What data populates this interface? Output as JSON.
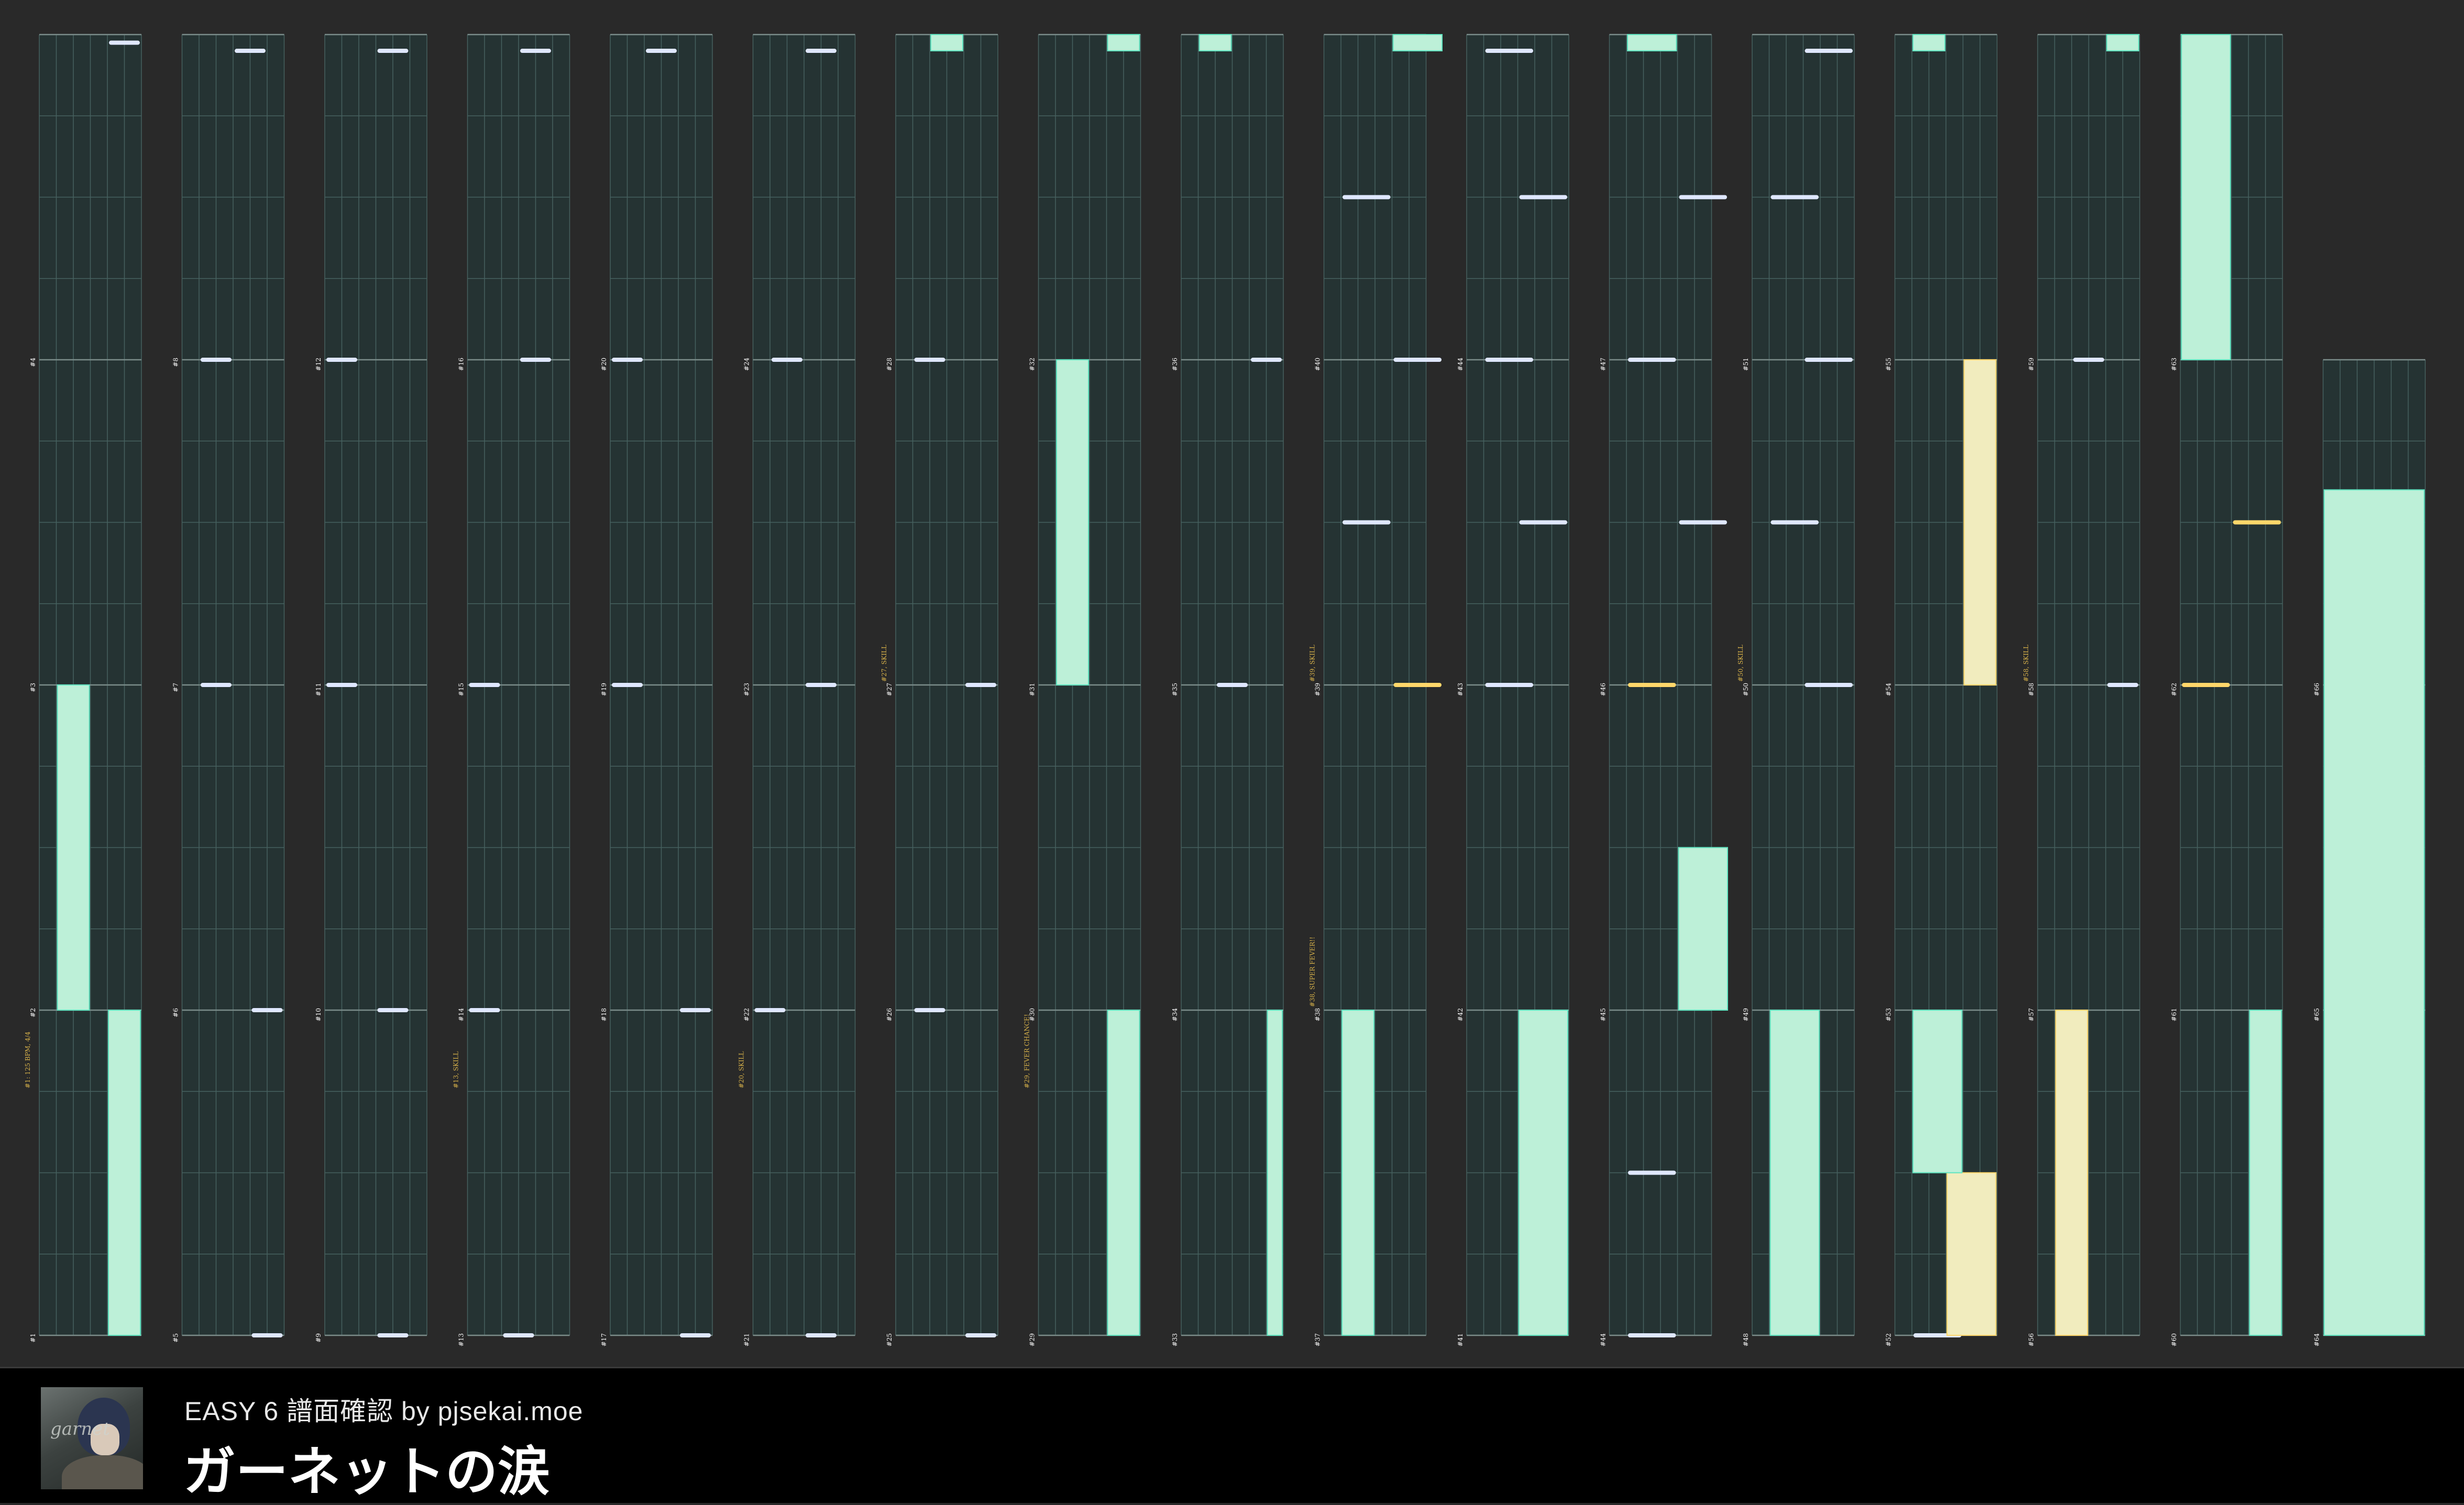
{
  "chart_header": {
    "difficulty": "EASY",
    "level": "6",
    "label": "譜面確認",
    "credit": "by pjsekai.moe",
    "full": "EASY 6 譜面確認 by pjsekai.moe"
  },
  "song": {
    "title": "ガーネットの涙",
    "jacket_icon": "album-jacket-icon"
  },
  "colors": {
    "background": "#292929",
    "lane_bg": "#253333",
    "lane_line": "#46615f",
    "beat_line": "#7b8c8a",
    "tap": "#dfe7ff",
    "flick": "#ffd76a",
    "hold": "#bdf0d8",
    "hold_edge": "#5fe4c0",
    "gold_hold": "#f1ecbe",
    "label_white": "#ffffff",
    "label_gold": "#d8b24a"
  },
  "columns": [
    {
      "measures": [
        "1",
        "2",
        "3",
        "4"
      ],
      "events": [
        {
          "m": 0,
          "b": 3,
          "text": "#1: 125 BPM, 4/4"
        }
      ],
      "notes": [
        {
          "t": "hold",
          "l": 8,
          "w": 4,
          "s": 0,
          "e": 4
        },
        {
          "t": "hold",
          "l": 2,
          "w": 4,
          "s": 4,
          "e": 8
        },
        {
          "t": "tap",
          "l": 8,
          "w": 4,
          "b": 15.9
        }
      ]
    },
    {
      "measures": [
        "5",
        "6",
        "7",
        "8"
      ],
      "events": [],
      "notes": [
        {
          "t": "tap",
          "l": 8,
          "w": 4,
          "b": 0
        },
        {
          "t": "tap",
          "l": 8,
          "w": 4,
          "b": 4
        },
        {
          "t": "tap",
          "l": 2,
          "w": 4,
          "b": 8
        },
        {
          "t": "tap",
          "l": 2,
          "w": 4,
          "b": 12
        },
        {
          "t": "tap",
          "l": 6,
          "w": 4,
          "b": 15.8
        }
      ]
    },
    {
      "measures": [
        "9",
        "10",
        "11",
        "12"
      ],
      "events": [],
      "notes": [
        {
          "t": "tap",
          "l": 6,
          "w": 4,
          "b": 0
        },
        {
          "t": "tap",
          "l": 6,
          "w": 4,
          "b": 4
        },
        {
          "t": "tap",
          "l": 0,
          "w": 4,
          "b": 8
        },
        {
          "t": "tap",
          "l": 0,
          "w": 4,
          "b": 12
        },
        {
          "t": "tap",
          "l": 6,
          "w": 4,
          "b": 15.8
        }
      ]
    },
    {
      "measures": [
        "13",
        "14",
        "15",
        "16"
      ],
      "events": [
        {
          "m": 0,
          "b": 3,
          "text": "#13, SKILL"
        }
      ],
      "notes": [
        {
          "t": "tap",
          "l": 4,
          "w": 4,
          "b": 0
        },
        {
          "t": "tap",
          "l": 0,
          "w": 4,
          "b": 4
        },
        {
          "t": "tap",
          "l": 0,
          "w": 4,
          "b": 8
        },
        {
          "t": "tap",
          "l": 6,
          "w": 4,
          "b": 12
        },
        {
          "t": "tap",
          "l": 6,
          "w": 4,
          "b": 15.8
        }
      ]
    },
    {
      "measures": [
        "17",
        "18",
        "19",
        "20"
      ],
      "events": [],
      "notes": [
        {
          "t": "tap",
          "l": 8,
          "w": 4,
          "b": 0
        },
        {
          "t": "tap",
          "l": 8,
          "w": 4,
          "b": 4
        },
        {
          "t": "tap",
          "l": 0,
          "w": 4,
          "b": 8
        },
        {
          "t": "tap",
          "l": 0,
          "w": 4,
          "b": 12
        },
        {
          "t": "tap",
          "l": 4,
          "w": 4,
          "b": 15.8
        }
      ]
    },
    {
      "measures": [
        "21",
        "22",
        "23",
        "24"
      ],
      "events": [
        {
          "m": 0,
          "b": 3,
          "text": "#20, SKILL"
        }
      ],
      "notes": [
        {
          "t": "tap",
          "l": 6,
          "w": 4,
          "b": 0
        },
        {
          "t": "tap",
          "l": 0,
          "w": 4,
          "b": 4
        },
        {
          "t": "tap",
          "l": 6,
          "w": 4,
          "b": 8
        },
        {
          "t": "tap",
          "l": 2,
          "w": 4,
          "b": 12
        },
        {
          "t": "tap",
          "l": 6,
          "w": 4,
          "b": 15.8
        }
      ]
    },
    {
      "measures": [
        "25",
        "26",
        "27",
        "28"
      ],
      "events": [
        {
          "m": 2,
          "b": 0,
          "text": "#27, SKILL"
        }
      ],
      "notes": [
        {
          "t": "tap",
          "l": 8,
          "w": 4,
          "b": 0
        },
        {
          "t": "tap",
          "l": 2,
          "w": 4,
          "b": 4
        },
        {
          "t": "tap",
          "l": 8,
          "w": 4,
          "b": 8
        },
        {
          "t": "tap",
          "l": 2,
          "w": 4,
          "b": 12
        },
        {
          "t": "hold",
          "l": 4,
          "w": 4,
          "s": 15.8,
          "e": 16
        }
      ]
    },
    {
      "measures": [
        "29",
        "30",
        "31",
        "32"
      ],
      "events": [
        {
          "m": 0,
          "b": 3,
          "text": "#29, FEVER CHANCE!"
        }
      ],
      "notes": [
        {
          "t": "hold",
          "l": 8,
          "w": 4,
          "s": 0,
          "e": 4
        },
        {
          "t": "hold",
          "l": 2,
          "w": 4,
          "s": 8,
          "e": 12
        },
        {
          "t": "hold",
          "l": 8,
          "w": 4,
          "s": 15.8,
          "e": 16
        }
      ]
    },
    {
      "measures": [
        "33",
        "34",
        "35",
        "36"
      ],
      "events": [],
      "notes": [
        {
          "t": "hold",
          "l": 10,
          "w": 2,
          "s": 0,
          "e": 4
        },
        {
          "t": "tap",
          "l": 4,
          "w": 4,
          "b": 8
        },
        {
          "t": "tap",
          "l": 8,
          "w": 4,
          "b": 12
        },
        {
          "t": "hold",
          "l": 2,
          "w": 4,
          "s": 15.8,
          "e": 16
        }
      ]
    },
    {
      "measures": [
        "37",
        "38",
        "39",
        "40"
      ],
      "events": [
        {
          "m": 1,
          "b": 0,
          "text": "#38, SUPER FEVER!!"
        },
        {
          "m": 2,
          "b": 0,
          "text": "#39, SKILL"
        }
      ],
      "notes": [
        {
          "t": "hold",
          "l": 2,
          "w": 4,
          "s": 0,
          "e": 4
        },
        {
          "t": "flick",
          "l": 8,
          "w": 6,
          "b": 8
        },
        {
          "t": "tap",
          "l": 2,
          "w": 6,
          "b": 10
        },
        {
          "t": "tap",
          "l": 8,
          "w": 6,
          "b": 12
        },
        {
          "t": "tap",
          "l": 2,
          "w": 6,
          "b": 14
        },
        {
          "t": "hold",
          "l": 8,
          "w": 6,
          "s": 15.8,
          "e": 16
        }
      ]
    },
    {
      "measures": [
        "41",
        "42",
        "43",
        "44"
      ],
      "events": [],
      "notes": [
        {
          "t": "hold",
          "l": 6,
          "w": 6,
          "s": 0,
          "e": 4
        },
        {
          "t": "tap",
          "l": 2,
          "w": 6,
          "b": 8
        },
        {
          "t": "tap",
          "l": 2,
          "w": 6,
          "b": 12
        },
        {
          "t": "tap",
          "l": 6,
          "w": 6,
          "b": 10
        },
        {
          "t": "tap",
          "l": 6,
          "w": 6,
          "b": 14
        },
        {
          "t": "tap",
          "l": 2,
          "w": 6,
          "b": 15.8
        }
      ]
    },
    {
      "measures": [
        "44",
        "45",
        "46",
        "47"
      ],
      "events": [],
      "notes": [
        {
          "t": "tap",
          "l": 2,
          "w": 6,
          "b": 0
        },
        {
          "t": "tap",
          "l": 2,
          "w": 6,
          "b": 2
        },
        {
          "t": "hold",
          "l": 8,
          "w": 6,
          "s": 4,
          "e": 6
        },
        {
          "t": "flick",
          "l": 2,
          "w": 6,
          "b": 8
        },
        {
          "t": "tap",
          "l": 2,
          "w": 6,
          "b": 12
        },
        {
          "t": "tap",
          "l": 8,
          "w": 6,
          "b": 10
        },
        {
          "t": "tap",
          "l": 8,
          "w": 6,
          "b": 14
        },
        {
          "t": "hold",
          "l": 2,
          "w": 6,
          "s": 15.8,
          "e": 16
        }
      ]
    },
    {
      "measures": [
        "48",
        "49",
        "50",
        "51"
      ],
      "events": [
        {
          "m": 2,
          "b": 0,
          "text": "#50, SKILL"
        }
      ],
      "notes": [
        {
          "t": "hold",
          "l": 2,
          "w": 6,
          "s": 0,
          "e": 4
        },
        {
          "t": "tap",
          "l": 6,
          "w": 6,
          "b": 8
        },
        {
          "t": "tap",
          "l": 2,
          "w": 6,
          "b": 10
        },
        {
          "t": "tap",
          "l": 6,
          "w": 6,
          "b": 12
        },
        {
          "t": "tap",
          "l": 2,
          "w": 6,
          "b": 14
        },
        {
          "t": "tap",
          "l": 6,
          "w": 6,
          "b": 15.8
        }
      ]
    },
    {
      "measures": [
        "52",
        "53",
        "54",
        "55"
      ],
      "events": [],
      "notes": [
        {
          "t": "tap",
          "l": 2,
          "w": 6,
          "b": 0
        },
        {
          "t": "goldhold",
          "l": 6,
          "w": 6,
          "s": 0,
          "e": 2
        },
        {
          "t": "hold",
          "l": 2,
          "w": 6,
          "s": 2,
          "e": 4
        },
        {
          "t": "goldhold",
          "l": 8,
          "w": 4,
          "s": 8,
          "e": 12
        },
        {
          "t": "hold",
          "l": 2,
          "w": 4,
          "s": 15.8,
          "e": 16
        }
      ]
    },
    {
      "measures": [
        "56",
        "57",
        "58",
        "59"
      ],
      "events": [
        {
          "m": 2,
          "b": 0,
          "text": "#58, SKILL"
        }
      ],
      "notes": [
        {
          "t": "goldhold",
          "l": 2,
          "w": 4,
          "s": 0,
          "e": 4
        },
        {
          "t": "tap",
          "l": 8,
          "w": 4,
          "b": 8
        },
        {
          "t": "tap",
          "l": 4,
          "w": 4,
          "b": 12
        },
        {
          "t": "hold",
          "l": 8,
          "w": 4,
          "s": 15.8,
          "e": 16
        }
      ]
    },
    {
      "measures": [
        "60",
        "61",
        "62",
        "63"
      ],
      "events": [],
      "notes": [
        {
          "t": "hold",
          "l": 8,
          "w": 4,
          "s": 0,
          "e": 4
        },
        {
          "t": "flick",
          "l": 0,
          "w": 6,
          "b": 8
        },
        {
          "t": "flick",
          "l": 6,
          "w": 6,
          "b": 10
        },
        {
          "t": "hold",
          "l": 0,
          "w": 6,
          "s": 12,
          "e": 16
        }
      ]
    },
    {
      "measures": [
        "64",
        "65",
        "66"
      ],
      "events": [],
      "notes": [
        {
          "t": "hold",
          "l": 0,
          "w": 12,
          "s": 0,
          "e": 10.4
        }
      ]
    }
  ]
}
